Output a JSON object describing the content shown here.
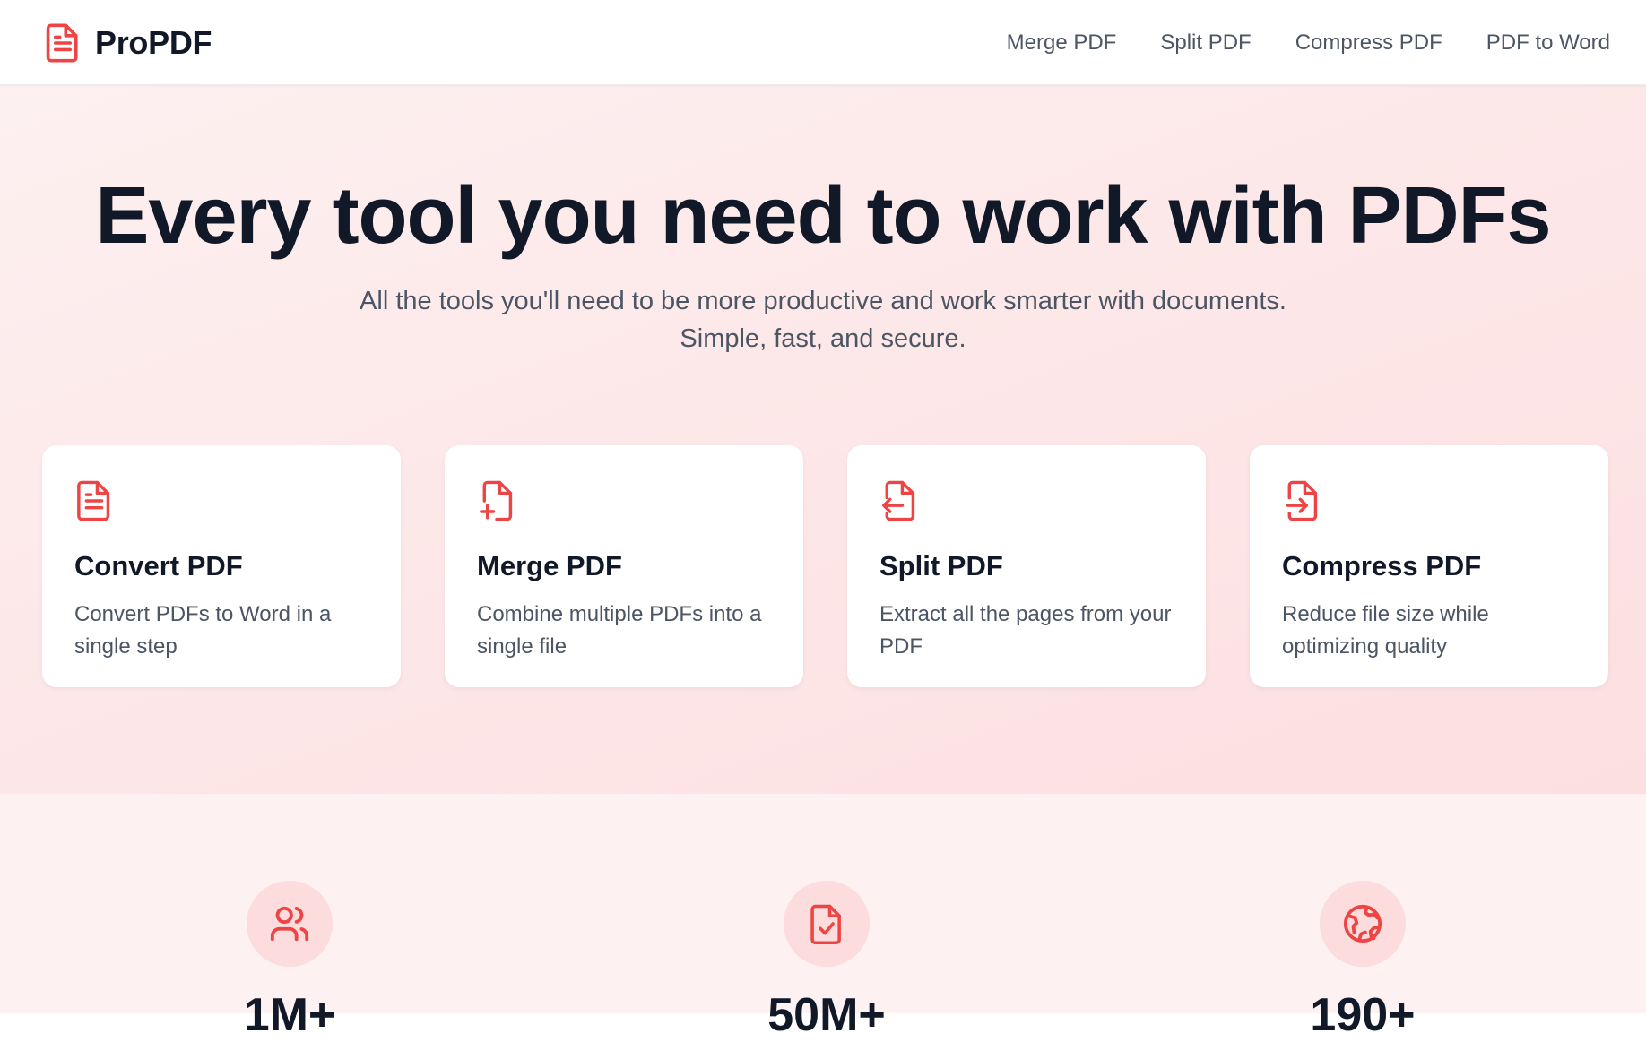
{
  "brand": {
    "name": "ProPDF",
    "logo_icon": "document-icon",
    "accent_color": "#ef4444"
  },
  "nav": {
    "items": [
      {
        "label": "Merge PDF"
      },
      {
        "label": "Split PDF"
      },
      {
        "label": "Compress PDF"
      },
      {
        "label": "PDF to Word"
      }
    ]
  },
  "hero": {
    "title": "Every tool you need to work with PDFs",
    "subtitle_line1": "All the tools you'll need to be more productive and work smarter with documents.",
    "subtitle_line2": "Simple, fast, and secure."
  },
  "tools": [
    {
      "icon": "document-text-icon",
      "title": "Convert PDF",
      "description": "Convert PDFs to Word in a single step"
    },
    {
      "icon": "file-plus-icon",
      "title": "Merge PDF",
      "description": "Combine multiple PDFs into a single file"
    },
    {
      "icon": "file-arrow-left-icon",
      "title": "Split PDF",
      "description": "Extract all the pages from your PDF"
    },
    {
      "icon": "file-arrow-right-icon",
      "title": "Compress PDF",
      "description": "Reduce file size while optimizing quality"
    }
  ],
  "stats": [
    {
      "icon": "users-icon",
      "value": "1M+"
    },
    {
      "icon": "file-check-icon",
      "value": "50M+"
    },
    {
      "icon": "globe-icon",
      "value": "190+"
    }
  ]
}
